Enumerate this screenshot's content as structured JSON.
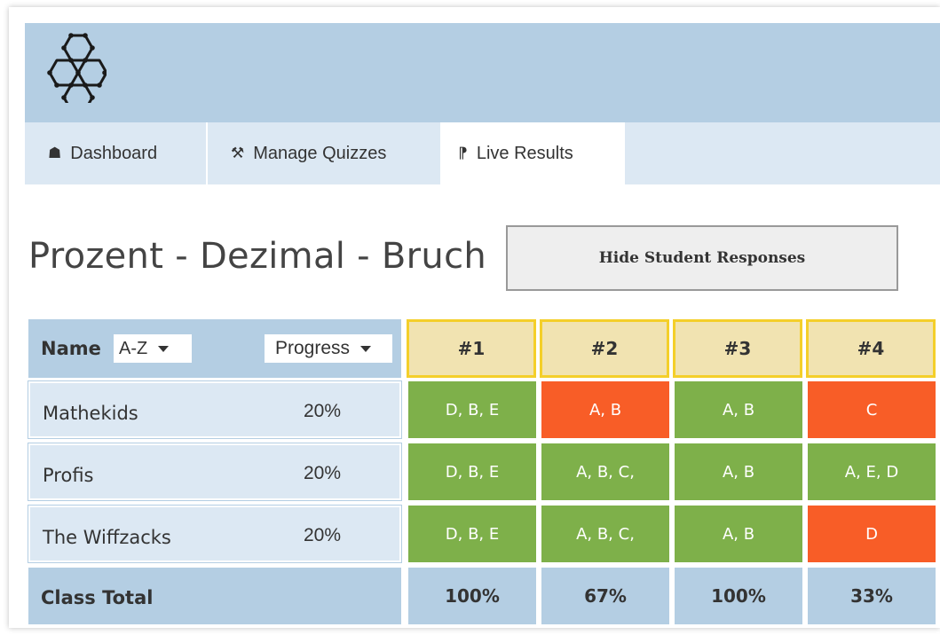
{
  "nav": {
    "items": [
      {
        "label": "Dashboard",
        "icon": "home-icon"
      },
      {
        "label": "Manage Quizzes",
        "icon": "wrench-icon"
      },
      {
        "label": "Live Results",
        "icon": "broadcast-icon"
      }
    ]
  },
  "quiz": {
    "title": "Prozent - Dezimal - Bruch",
    "hide_button": "Hide Student Responses"
  },
  "table": {
    "name_label": "Name",
    "sort_value": "A-Z",
    "progress_value": "Progress",
    "questions": [
      "#1",
      "#2",
      "#3",
      "#4"
    ],
    "rows": [
      {
        "name": "Mathekids",
        "progress": "20%",
        "answers": [
          "D, B, E",
          "A, B",
          "A, B",
          "C"
        ],
        "correct": [
          true,
          false,
          true,
          false
        ]
      },
      {
        "name": "Profis",
        "progress": "20%",
        "answers": [
          "D, B, E",
          "A, B, C,",
          "A, B",
          "A, E, D"
        ],
        "correct": [
          true,
          true,
          true,
          true
        ]
      },
      {
        "name": "The Wiffzacks",
        "progress": "20%",
        "answers": [
          "D, B, E",
          "A, B, C,",
          "A, B",
          "D"
        ],
        "correct": [
          true,
          true,
          true,
          false
        ]
      }
    ],
    "total_label": "Class Total",
    "totals": [
      "100%",
      "67%",
      "100%",
      "33%"
    ]
  },
  "colors": {
    "header_blue": "#b4cee3",
    "nav_blue": "#dce8f3",
    "correct_green": "#7eb04a",
    "wrong_red": "#f85d27",
    "question_head": "#f1e3b1"
  }
}
